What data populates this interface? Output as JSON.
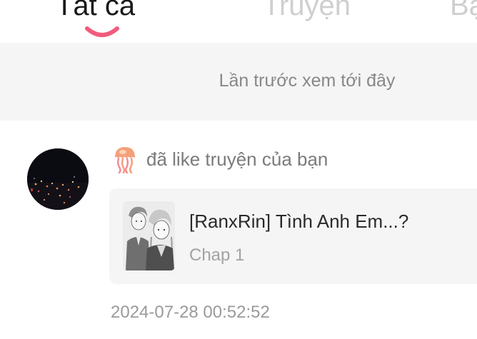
{
  "tabs": {
    "items": [
      {
        "label": "Tất cả",
        "active": true
      },
      {
        "label": "Truyện",
        "active": false
      },
      {
        "label": "Bạ",
        "active": false
      }
    ],
    "accent_color": "#f25b7a"
  },
  "last_seen": {
    "label": "Lần trước xem tới đây"
  },
  "notification": {
    "avatar_icon": "city-night-avatar",
    "reaction_icon": "jellyfish-icon",
    "action_text": "đã like truyện của bạn",
    "story": {
      "title": "[RanxRin] Tình Anh Em...?",
      "chapter": "Chap 1",
      "cover_icon": "manga-cover-thumbnail"
    },
    "timestamp": "2024-07-28 00:52:52"
  }
}
